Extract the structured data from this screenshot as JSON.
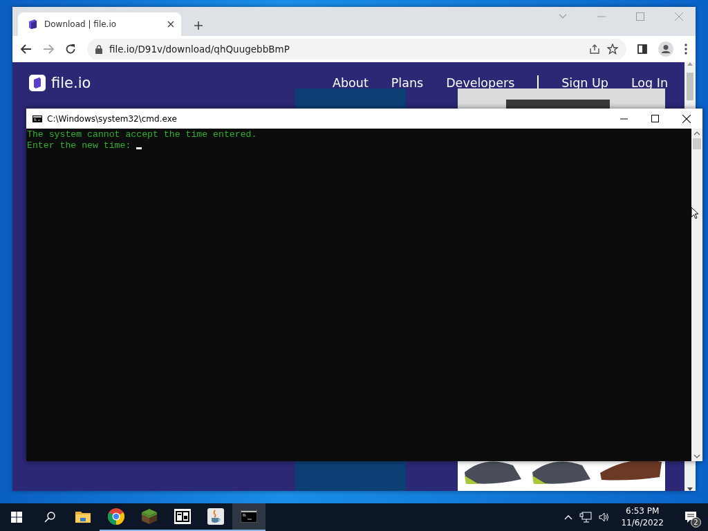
{
  "browser": {
    "tab_title": "Download | file.io",
    "url": "file.io/D91v/download/qhQuugebbBmP",
    "site": {
      "logo_text": "file.io",
      "nav": [
        "About",
        "Plans",
        "Developers",
        "Sign Up",
        "Log In"
      ]
    }
  },
  "console": {
    "title": "C:\\Windows\\system32\\cmd.exe",
    "lines": [
      "The system cannot accept the time entered.",
      "Enter the new time:"
    ]
  },
  "taskbar": {
    "apps": [
      {
        "kind": "folder",
        "running": false,
        "selected": false
      },
      {
        "kind": "browser",
        "running": true,
        "selected": false
      },
      {
        "kind": "block",
        "running": true,
        "selected": false
      },
      {
        "kind": "archiver",
        "running": true,
        "selected": false
      },
      {
        "kind": "java",
        "running": true,
        "selected": false
      },
      {
        "kind": "terminal",
        "running": true,
        "selected": true
      }
    ],
    "time": "6:53 PM",
    "date": "11/6/2022",
    "notifications": "2"
  }
}
